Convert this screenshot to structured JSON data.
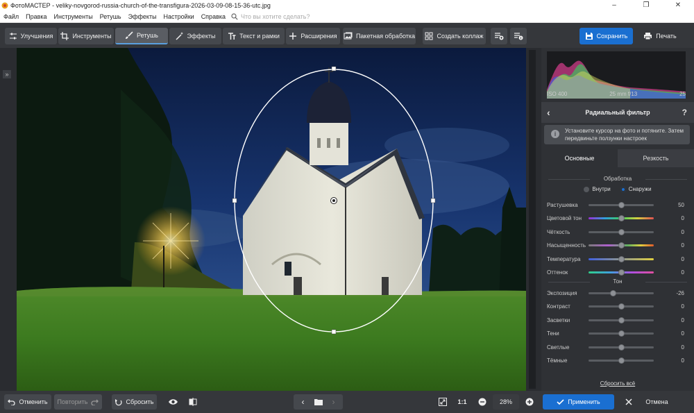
{
  "window": {
    "title": "ФотоМАСТЕР - veliky-novgorod-russia-church-of-the-transfigura-2026-03-09-08-15-36-utc.jpg"
  },
  "menu": {
    "items": [
      "Файл",
      "Правка",
      "Инструменты",
      "Ретушь",
      "Эффекты",
      "Настройки",
      "Справка"
    ],
    "search_placeholder": "Что вы хотите сделать?"
  },
  "toolbar": {
    "improve": "Улучшения",
    "tools": "Инструменты",
    "retouch": "Ретушь",
    "effects": "Эффекты",
    "text": "Текст и рамки",
    "extensions": "Расширения",
    "batch": "Пакетная обработка",
    "collage": "Создать коллаж",
    "save": "Сохранить",
    "print": "Печать"
  },
  "histogram": {
    "iso": "ISO 400",
    "lens": "25 mm f/13",
    "extra": "25"
  },
  "panel": {
    "title": "Радиальный фильтр",
    "hint": "Установите курсор на фото и потяните. Затем передвиньте ползунки настроек",
    "tabs": [
      "Основные",
      "Резкость"
    ],
    "processing_label": "Обработка",
    "radio_inside": "Внутри",
    "radio_outside": "Снаружи",
    "tone_label": "Тон",
    "sliders_processing": [
      {
        "label": "Растушевка",
        "value": "50",
        "pos": 0.5
      },
      {
        "label": "Цветовой тон",
        "value": "0",
        "pos": 0.5
      },
      {
        "label": "Чёткость",
        "value": "0",
        "pos": 0.5
      },
      {
        "label": "Насыщенность",
        "value": "0",
        "pos": 0.5
      },
      {
        "label": "Температура",
        "value": "0",
        "pos": 0.5
      },
      {
        "label": "Оттенок",
        "value": "0",
        "pos": 0.5
      }
    ],
    "sliders_tone": [
      {
        "label": "Экспозиция",
        "value": "-26",
        "pos": 0.37
      },
      {
        "label": "Контраст",
        "value": "0",
        "pos": 0.5
      },
      {
        "label": "Засветки",
        "value": "0",
        "pos": 0.5
      },
      {
        "label": "Тени",
        "value": "0",
        "pos": 0.5
      },
      {
        "label": "Светлые",
        "value": "0",
        "pos": 0.5
      },
      {
        "label": "Тёмные",
        "value": "0",
        "pos": 0.5
      }
    ],
    "reset_all": "Сбросить всё"
  },
  "bottom": {
    "undo": "Отменить",
    "redo": "Повторить",
    "reset": "Сбросить",
    "zoom_1to1": "1:1",
    "zoom": "28%",
    "apply": "Применить",
    "cancel": "Отмена"
  }
}
